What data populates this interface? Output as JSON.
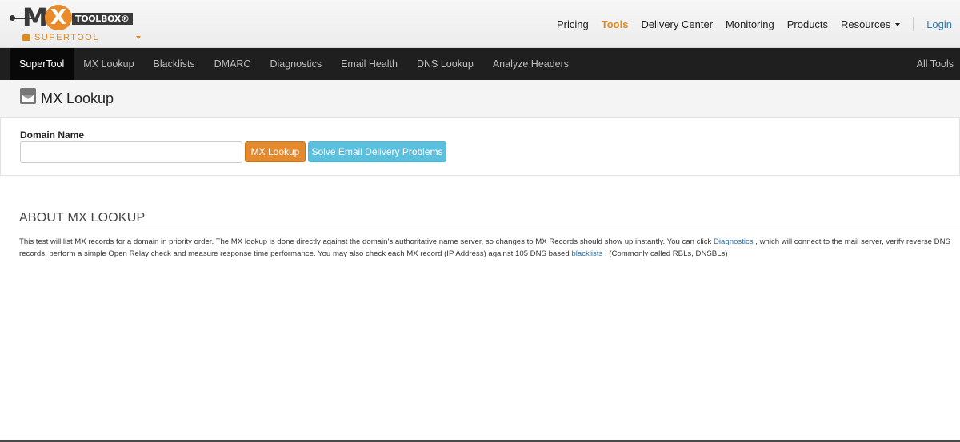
{
  "logo": {
    "brand_m": "M",
    "brand_x": "X",
    "brand_toolbox": "TOOLBOX",
    "brand_mark": "®",
    "product": "SUPERTOOL"
  },
  "topnav": {
    "items": [
      {
        "label": "Pricing"
      },
      {
        "label": "Tools"
      },
      {
        "label": "Delivery Center"
      },
      {
        "label": "Monitoring"
      },
      {
        "label": "Products"
      },
      {
        "label": "Resources"
      }
    ],
    "login": "Login",
    "active_color": "#e08a1e"
  },
  "toolbar": {
    "tabs": [
      {
        "label": "SuperTool"
      },
      {
        "label": "MX Lookup"
      },
      {
        "label": "Blacklists"
      },
      {
        "label": "DMARC"
      },
      {
        "label": "Diagnostics"
      },
      {
        "label": "Email Health"
      },
      {
        "label": "DNS Lookup"
      },
      {
        "label": "Analyze Headers"
      }
    ],
    "all_tools": "All Tools"
  },
  "page": {
    "title": "MX Lookup",
    "icon": "mail-icon"
  },
  "form": {
    "label": "Domain Name",
    "value": "",
    "placeholder": "",
    "mx_button": "MX Lookup",
    "solve_button": "Solve Email Delivery Problems",
    "mx_color": "#e48a2e",
    "solve_color": "#5bc0de"
  },
  "about": {
    "title": "ABOUT MX LOOKUP",
    "text_1": "This test will list MX records for a domain in priority order. The MX lookup is done directly against the domain's authoritative name server, so changes to MX Records should show up instantly. You can click ",
    "link_diagnostics": "Diagnostics",
    "text_2": " , which will connect to the mail server, verify reverse DNS records, perform a simple Open Relay check and measure response time performance. You may also check each MX record (IP Address) against 105 DNS based ",
    "link_blacklists": "blacklists",
    "text_3": " . (Commonly called RBLs, DNSBLs)"
  }
}
